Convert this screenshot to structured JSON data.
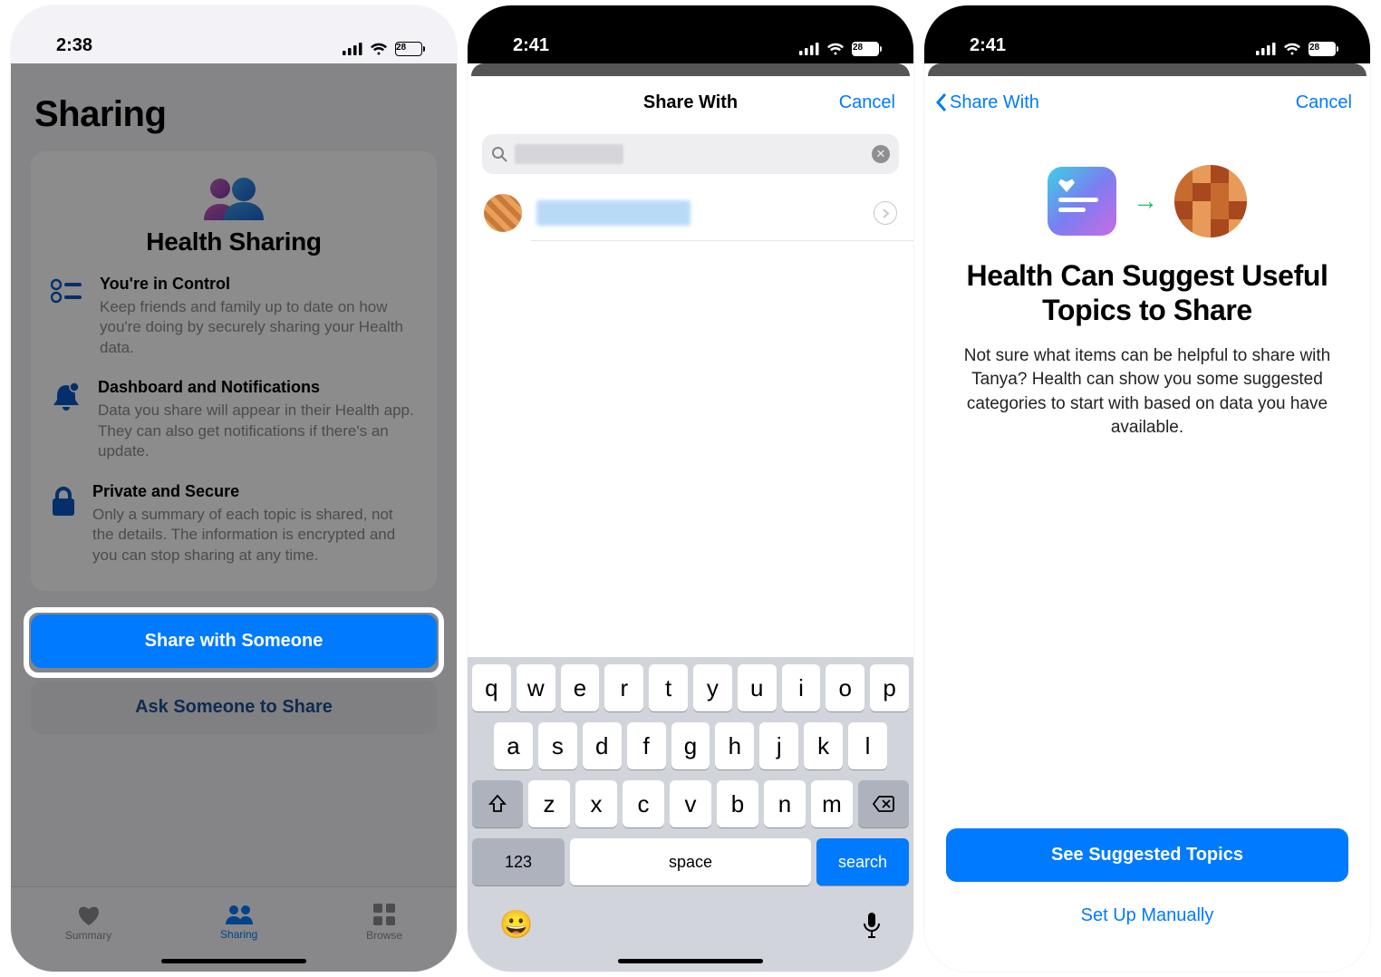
{
  "screen1": {
    "status": {
      "time": "2:38",
      "battery": "28"
    },
    "page_title": "Sharing",
    "card_title": "Health Sharing",
    "features": [
      {
        "title": "You're in Control",
        "desc": "Keep friends and family up to date on how you're doing by securely sharing your Health data."
      },
      {
        "title": "Dashboard and Notifications",
        "desc": "Data you share will appear in their Health app. They can also get notifications if there's an update."
      },
      {
        "title": "Private and Secure",
        "desc": "Only a summary of each topic is shared, not the details. The information is encrypted and you can stop sharing at any time."
      }
    ],
    "share_button": "Share with Someone",
    "ask_button": "Ask Someone to Share",
    "tabs": {
      "summary": "Summary",
      "sharing": "Sharing",
      "browse": "Browse"
    }
  },
  "screen2": {
    "status": {
      "time": "2:41",
      "battery": "28"
    },
    "nav_title": "Share With",
    "cancel": "Cancel",
    "keyboard": {
      "row1": [
        "q",
        "w",
        "e",
        "r",
        "t",
        "y",
        "u",
        "i",
        "o",
        "p"
      ],
      "row2": [
        "a",
        "s",
        "d",
        "f",
        "g",
        "h",
        "j",
        "k",
        "l"
      ],
      "row3": [
        "z",
        "x",
        "c",
        "v",
        "b",
        "n",
        "m"
      ],
      "num": "123",
      "space": "space",
      "search": "search"
    }
  },
  "screen3": {
    "status": {
      "time": "2:41",
      "battery": "28"
    },
    "back": "Share With",
    "cancel": "Cancel",
    "title": "Health Can Suggest Useful Topics to Share",
    "desc": "Not sure what items can be helpful to share with Tanya? Health can show you some suggested categories to start with based on data you have available.",
    "primary_button": "See Suggested Topics",
    "secondary_button": "Set Up Manually"
  }
}
